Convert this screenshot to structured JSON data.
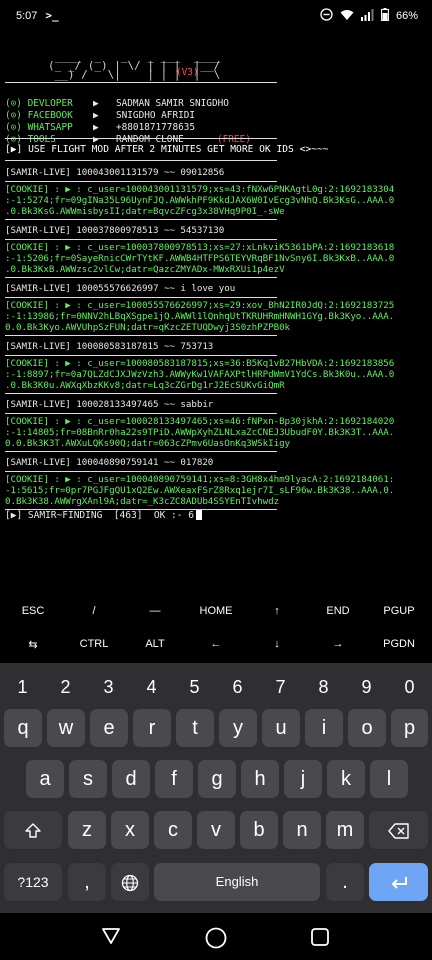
{
  "status_bar": {
    "time": "5:07",
    "battery": "66%"
  },
  "terminal": {
    "logo_lines": [
      " ____  _   _   _ ___  ____",
      "(_ _/ (_) | \\/ | | |  |__/",
      " __) /   \\|    | | |  |  \\"
    ],
    "version": "(V3)",
    "menu": [
      {
        "key": "(⊙) DEVLOPER",
        "arrow": "▶",
        "value": "SADMAN SAMIR SNIGDHO"
      },
      {
        "key": "(⊙) FACEBOOK",
        "arrow": "▶",
        "value": "SNIGDHO AFRIDI"
      },
      {
        "key": "(⊙) WHATSAPP",
        "arrow": "▶",
        "value": "+8801871778635"
      },
      {
        "key": "(⊙) TOOLS",
        "arrow": "▶",
        "value": "RANDOM CLONE",
        "badge": "(FREE)"
      }
    ],
    "banner": "[▶] USE FLIGHT MOD AFTER 2 MINUTES GET MORE OK IDS <>~~~",
    "results": [
      {
        "head": "[SAMIR-LIVE] 100043001131579 ~~ 09012856",
        "cookie": [
          "[COOKIE] : ▶ : c_user=100043001131579;xs=43:fNXw6PNKAgtL0g:2:1692183304",
          ":-1:5274;fr=09gINa35L96UynFJQ.AWWkhPF9KkdJAX6W0IvEcg3vNhQ.Bk3KsG..AAA.0",
          ".0.Bk3KsG.AWWmisbysII;datr=BqvcZFcg3x38VHq9P0I_-sWe"
        ]
      },
      {
        "head": "[SAMIR-LIVE] 100037800978513 ~~ 54537130",
        "cookie": [
          "[COOKIE] : ▶ : c_user=100037800978513;xs=27:xLnkviK5361bPA:2:1692183618",
          ":-1:5206;fr=0SayeRnicCWrTYtKF.AWWB4HTFPS6TEYVRqBF1NvSny6I.Bk3KxB..AAA.0",
          ".0.Bk3KxB.AWWzsc2vlCw;datr=QazcZMYADx-MWxRXUi1p4ezV"
        ]
      },
      {
        "head": "[SAMIR-LIVE] 100055576626997 ~~ i love you",
        "cookie": [
          "[COOKIE] : ▶ : c_user=100055576626997;xs=29:xov_BhN2IR0JdQ:2:1692183725",
          ":-1:13986;fr=0NNV2hLBqXSgpe1jQ.AWWl1lQnhqUtTKRUHRmHNWH1GYg.Bk3Kyo..AAA.",
          "0.0.Bk3Kyo.AWVUhpSzFUN;datr=qKzcZETUQDwyj3S0zhPZPB0k"
        ]
      },
      {
        "head": "[SAMIR-LIVE] 100080583187815 ~~ 753713",
        "cookie": [
          "[COOKIE] : ▶ : c_user=100080583187815;xs=36:B5Kq1vB27HbVDA:2:1692183856",
          ":-1:8897;fr=0a7QLZdCJXJWzVzh3.AWWyKw1VAFAXPtlHRPdWmV1YdCs.Bk3K0u..AAA.0",
          ".0.Bk3K0u.AWXqXbzKKv8;datr=Lq3cZGrDg1rJ2EcSUKvGiQmR"
        ]
      },
      {
        "head": "[SAMIR-LIVE] 100028133497465 ~~ sabbir",
        "cookie": [
          "[COOKIE] : ▶ : c_user=100028133497465;xs=46:fNPxn-Bp30jkhA:2:1692184020",
          ":-1:14805;fr=08BnRr0ha22s9TPiD.AWWpXyhZLNLxaZcCNEJ3UbudF0Y.Bk3K3T..AAA.",
          "0.0.Bk3K3T.AWXuLQKs90Q;datr=063cZPmv6UasOnKq3WSkIigy"
        ]
      },
      {
        "head": "[SAMIR-LIVE] 100040890759141 ~~ 017820",
        "cookie": [
          "[COOKIE] : ▶ : c_user=100040890759141;xs=8:3GH8x4hm9lyacA:2:1692184061:",
          "-1:5615;fr=0pr7PGJFgQU1xQ2Ew.AWXeaxFSrZ8Rxq1ejr7I_sLF96w.Bk3K38..AAA.0.",
          "0.Bk3K38.AWWrgXAnl9A;datr=_K3cZC8ADUb4SSYEnTIvhwdz"
        ]
      }
    ],
    "footer": "[▶] SAMIR~FINDING  [463]  OK :- 6"
  },
  "extra_keys": {
    "row1": [
      "ESC",
      "/",
      "—",
      "HOME",
      "↑",
      "END",
      "PGUP"
    ],
    "row2": [
      "⇆",
      "CTRL",
      "ALT",
      "←",
      "↓",
      "→",
      "PGDN"
    ]
  },
  "keyboard": {
    "numbers": [
      "1",
      "2",
      "3",
      "4",
      "5",
      "6",
      "7",
      "8",
      "9",
      "0"
    ],
    "row1": [
      "q",
      "w",
      "e",
      "r",
      "t",
      "y",
      "u",
      "i",
      "o",
      "p"
    ],
    "row2": [
      "a",
      "s",
      "d",
      "f",
      "g",
      "h",
      "j",
      "k",
      "l"
    ],
    "row3": [
      "z",
      "x",
      "c",
      "v",
      "b",
      "n",
      "m"
    ],
    "symbols_label": "?123",
    "comma": ",",
    "space_label": "English",
    "period": "."
  }
}
